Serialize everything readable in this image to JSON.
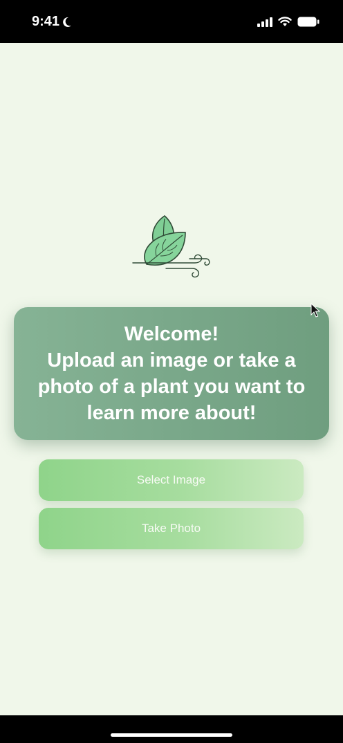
{
  "status_bar": {
    "time": "9:41",
    "icons": [
      "moon-icon",
      "cellular-signal-icon",
      "wifi-icon",
      "battery-icon"
    ]
  },
  "logo": {
    "icon": "leaf-wind-icon"
  },
  "welcome": {
    "line1": "Welcome!",
    "line2": "Upload an image or take a",
    "line3": "photo of a plant you want to",
    "line4": "learn more about!"
  },
  "buttons": {
    "select_image": "Select Image",
    "take_photo": "Take Photo"
  },
  "colors": {
    "background": "#f0f7ea",
    "card": "#7aa88a",
    "button": "#a7dd9f",
    "leaf": "#7fce95"
  }
}
